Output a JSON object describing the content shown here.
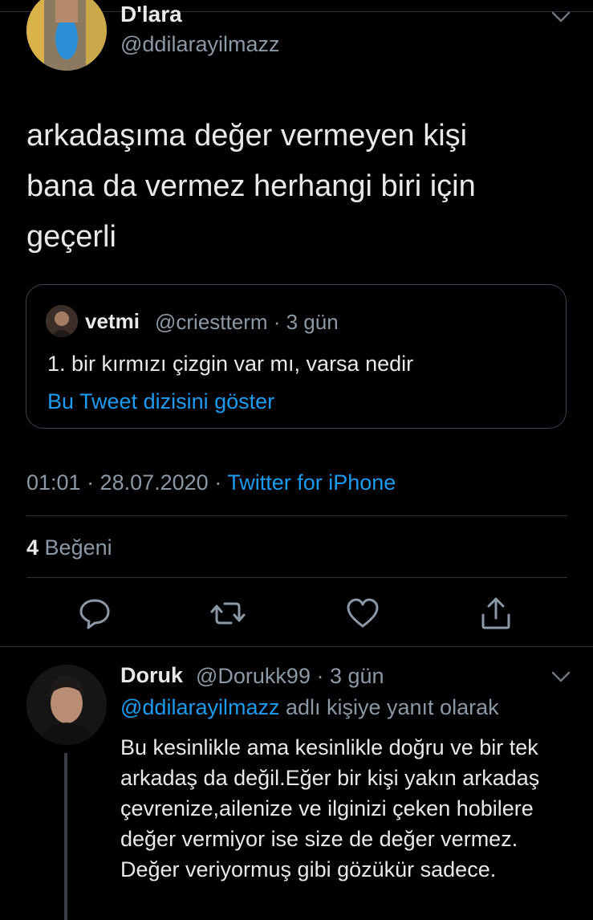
{
  "main_tweet": {
    "author_name": "D'lara",
    "author_handle": "@ddilarayilmazz",
    "text": "arkadaşıma değer vermeyen kişi bana da vermez herhangi biri için geçerli",
    "quoted": {
      "author_name": "vetmi",
      "meta": "@criestterm · 3 gün",
      "text": "1. bir kırmızı çizgin var mı, varsa nedir",
      "thread_link": "Bu Tweet dizisini göster"
    },
    "time": "01:01 · 28.07.2020 · ",
    "source": "Twitter for iPhone",
    "likes_count": "4",
    "likes_label": "Beğeni",
    "actions": [
      "reply-icon",
      "retweet-icon",
      "like-icon",
      "share-icon"
    ]
  },
  "reply": {
    "author_name": "Doruk",
    "meta": "@Dorukk99 · 3 gün",
    "replying_to": "@ddilarayilmazz",
    "replying_suffix": " adlı kişiye yanıt olarak",
    "text": "Bu kesinlikle ama kesinlikle doğru ve bir tek arkadaş da değil.Eğer bir kişi yakın arkadaş çevrenize,ailenize ve ilginizi çeken hobilere değer vermiyor ise size de değer vermez. Değer veriyormuş gibi gözükür sadece."
  },
  "colors": {
    "accent": "#1d9bf0",
    "secondary_text": "#8b98a5",
    "background": "#000000"
  }
}
